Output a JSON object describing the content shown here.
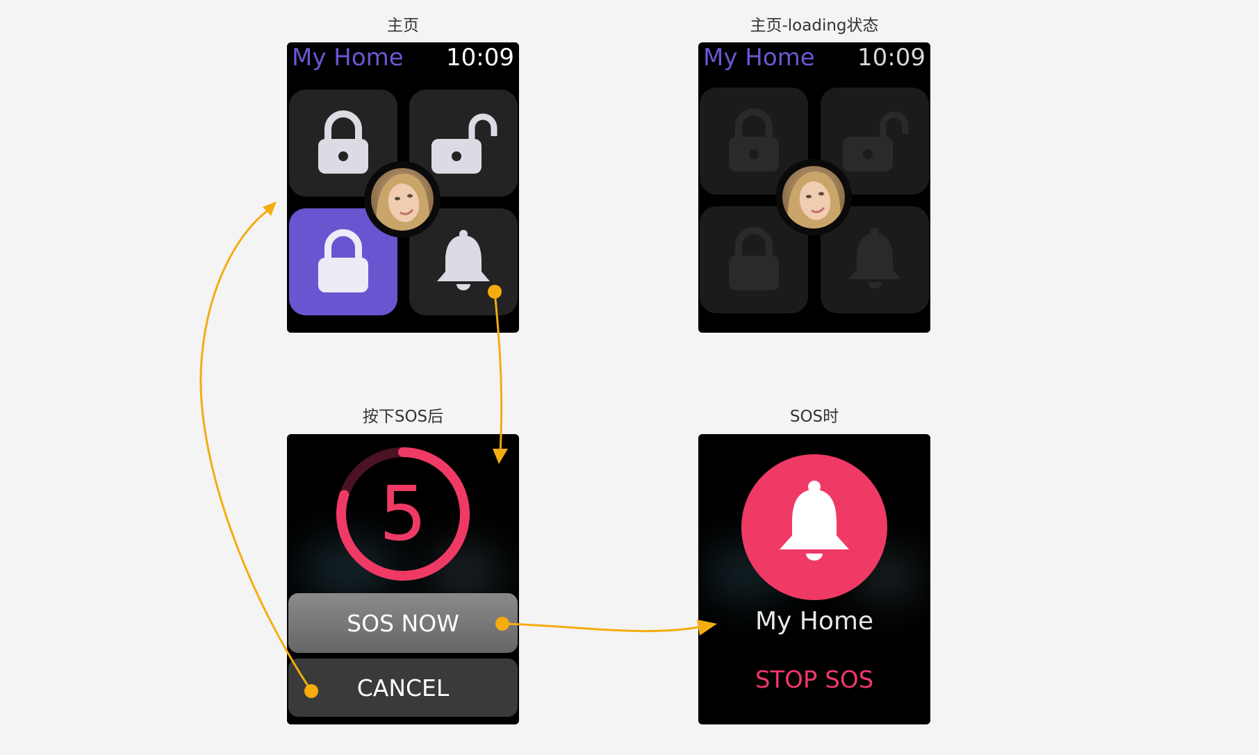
{
  "captions": {
    "home": "主页",
    "home_loading": "主页-loading状态",
    "after_sos_press": "按下SOS后",
    "during_sos": "SOS时"
  },
  "home_screen": {
    "title": "My Home",
    "time": "10:09",
    "tiles": [
      {
        "icon": "lock-icon",
        "state": "default"
      },
      {
        "icon": "unlock-icon",
        "state": "default"
      },
      {
        "icon": "night-lock-icon",
        "state": "active"
      },
      {
        "icon": "bell-icon",
        "state": "default"
      }
    ]
  },
  "loading_screen": {
    "title": "My Home",
    "time": "10:09"
  },
  "countdown_screen": {
    "countdown_number": "5",
    "ring_progress": 0.8,
    "sos_now_label": "SOS NOW",
    "cancel_label": "CANCEL"
  },
  "sos_screen": {
    "home_name": "My Home",
    "stop_label": "STOP SOS"
  },
  "colors": {
    "accent_purple": "#6a55d0",
    "alert_pink": "#ef3a66",
    "flow_arrow": "#f4ac0f",
    "icon_light": "#dcdbe3"
  }
}
